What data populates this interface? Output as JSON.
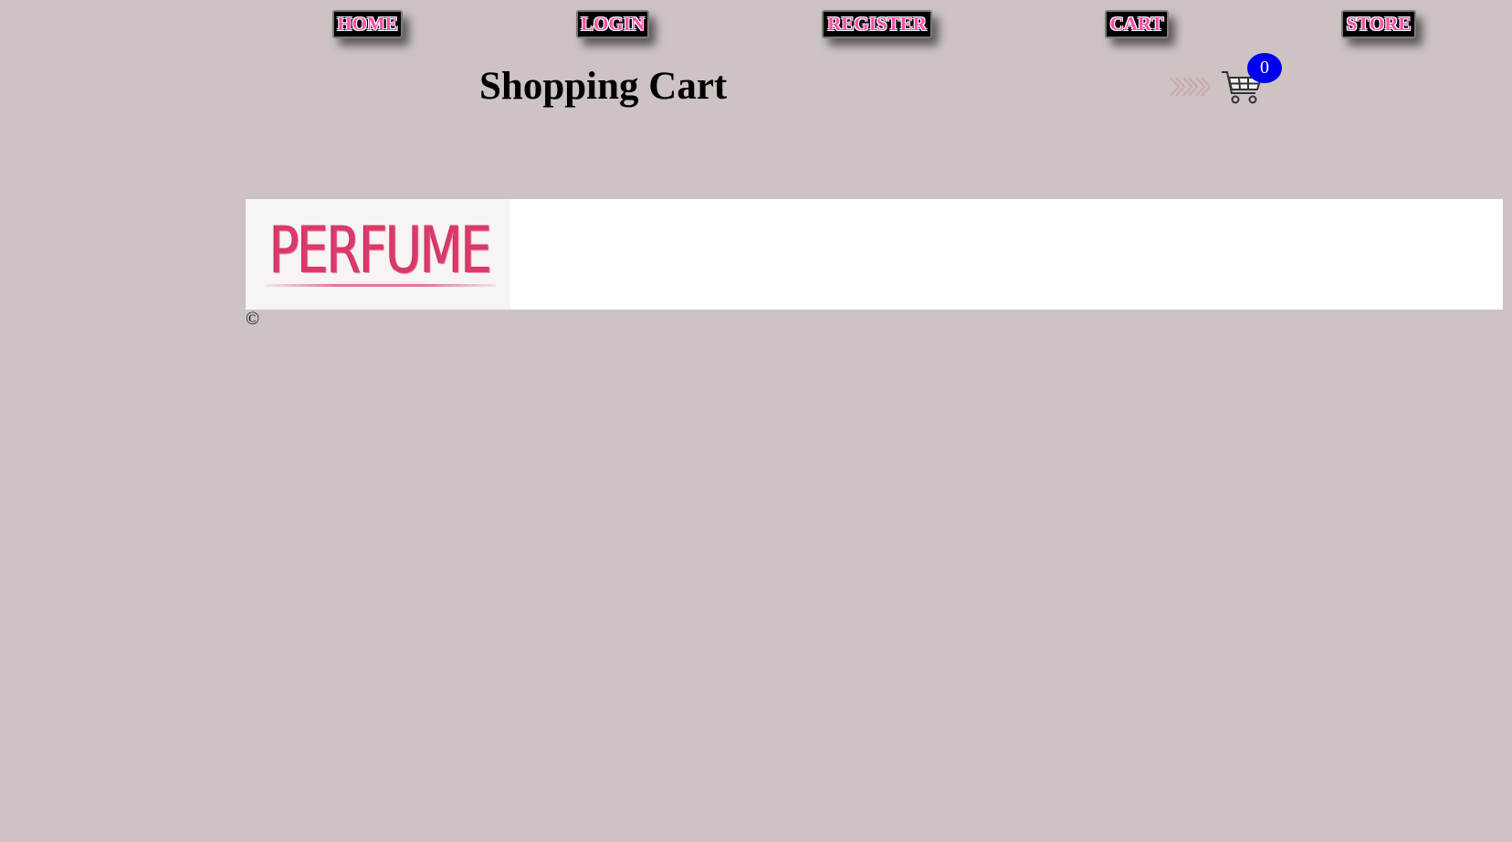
{
  "nav": {
    "home": "HOME",
    "login": "LOGIN",
    "register": "REGISTER",
    "cart": "CART",
    "store": "STORE"
  },
  "header": {
    "title": "Shopping Cart",
    "cart_count": "0",
    "icons": [
      "chevrons-right-icon",
      "shopping-cart-icon"
    ]
  },
  "banner": {
    "logo_text": "PERFUME"
  },
  "footer": {
    "copyright": "©"
  },
  "colors": {
    "background": "#cdc3c3",
    "nav_button_bg": "#000000",
    "nav_text": "#ff4fa8",
    "badge": "#0000ee",
    "logo_text": "#d93a6a"
  }
}
